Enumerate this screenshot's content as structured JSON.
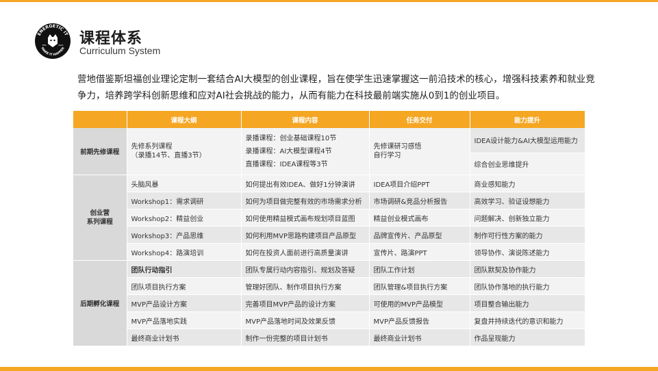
{
  "header": {
    "logo": {
      "ring_text": "ENERGETIC IT",
      "bottom_text": "MAKE IT HAPPEN",
      "est": "EST.",
      "year": "2021"
    },
    "title": "课程体系",
    "subtitle": "Curriculum System"
  },
  "intro": "营地借鉴斯坦福创业理论定制一套结合AI大模型的创业课程，旨在使学生迅速掌握这一前沿技术的核心，增强科技素养和就业竞争力，培养跨学科创新思维和应对AI社会挑战的能力，从而有能力在科技最前端实施从0到1的创业项目。",
  "colors": {
    "accent": "#f5a623",
    "header_text": "#ffffff",
    "row_light": "#f3f3f3",
    "row_dark": "#e7e7e7",
    "label_bg": "#d9d9d9"
  },
  "table": {
    "headers": [
      "",
      "课程大纲",
      "课程内容",
      "任务交付",
      "能力提升"
    ],
    "phase1": {
      "label": "前期先修课程",
      "outline": [
        "先修系列课程",
        "（录播14节、直播3节）"
      ],
      "content": [
        "录播课程：创业基础课程10节",
        "录播课程：AI大模型课程4节",
        "直播课程：IDEA课程等3节"
      ],
      "delivery": [
        "先修课研习感悟",
        "自行学习"
      ],
      "skills": [
        "IDEA设计能力&AI大模型运用能力",
        "综合创业思维提升"
      ]
    },
    "phase2": {
      "label": [
        "创业营",
        "系列课程"
      ],
      "rows": [
        {
          "outline": "头脑风暴",
          "content": "如何提出有效IDEA、做好1分钟演讲",
          "delivery": "IDEA项目介绍PPT",
          "skills": "商业感知能力"
        },
        {
          "outline": "Workshop1：需求调研",
          "content": "如何为项目做完整有效的市场需求分析",
          "delivery": "市场调研&竞品分析报告",
          "skills": "高效学习、验证设想能力"
        },
        {
          "outline": "Workshop2：精益创业",
          "content": "如何使用精益模式画布规划项目蓝图",
          "delivery": "精益创业模式画布",
          "skills": "问题解决、创新独立能力"
        },
        {
          "outline": "Workshop3：产品思维",
          "content": "如何利用MVP思路构建项目产品原型",
          "delivery": "品牌宣传片、产品原型",
          "skills": "制作可行性方案的能力"
        },
        {
          "outline": "Workshop4：路演培训",
          "content": "如何在投资人面前进行高质量演讲",
          "delivery": "宣传片、路演PPT",
          "skills": "领导协作、演说陈述能力"
        }
      ]
    },
    "phase3": {
      "label": "后期孵化课程",
      "rows": [
        {
          "outline": "团队行动指引",
          "content": "团队专属行动内容指引、规划及答疑",
          "delivery": "团队工作计划",
          "skills": "团队默契及协作能力"
        },
        {
          "outline": "团队项目执行方案",
          "content": "管理好团队、制作项目执行方案",
          "delivery": "团队管理&项目执行方案",
          "skills": "团队协作落地的执行能力"
        },
        {
          "outline": "MVP产品设计方案",
          "content": "完善项目MVP产品的设计方案",
          "delivery": "可使用的MVP产品模型",
          "skills": "项目整合输出能力"
        },
        {
          "outline": "MVP产品落地实践",
          "content": "MVP产品落地时间及效果反馈",
          "delivery": "MVP产品反馈报告",
          "skills": "复盘并持续迭代的意识和能力"
        },
        {
          "outline": "最终商业计划书",
          "content": "制作一份完整的项目计划书",
          "delivery": "最终商业计划书",
          "skills": "作品呈现能力"
        }
      ]
    }
  }
}
